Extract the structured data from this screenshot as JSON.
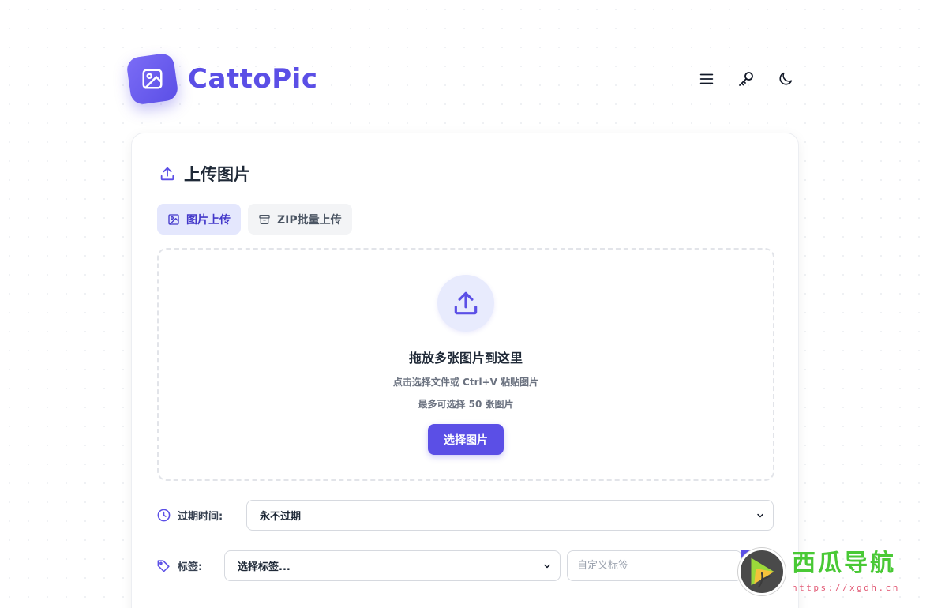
{
  "app": {
    "brand_name": "CattoPic",
    "brand_color": "#5b4fe6"
  },
  "header": {
    "icons": [
      "menu-icon",
      "key-icon",
      "moon-icon"
    ]
  },
  "upload": {
    "section_title": "上传图片",
    "tabs": [
      {
        "label": "图片上传",
        "icon": "image-icon",
        "active": true
      },
      {
        "label": "ZIP批量上传",
        "icon": "archive-icon",
        "active": false
      }
    ],
    "dropzone": {
      "title": "拖放多张图片到这里",
      "subtitle": "点击选择文件或 Ctrl+V 粘贴图片",
      "limit_text": "最多可选择 50 张图片",
      "button_label": "选择图片"
    }
  },
  "options": {
    "expiry_label": "过期时间:",
    "expiry_value": "永不过期",
    "tags_label": "标签:",
    "tags_select_placeholder": "选择标签...",
    "custom_tag_placeholder": "自定义标签"
  },
  "watermark": {
    "title": "西瓜导航",
    "url": "https://xgdh.cn"
  }
}
